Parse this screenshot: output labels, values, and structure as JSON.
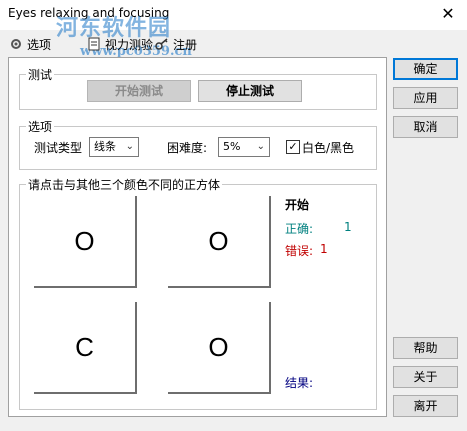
{
  "window": {
    "title": "Eyes relaxing and focusing",
    "close_glyph": "✕",
    "watermark_text": "河东软件园",
    "watermark_url": "www.pc0359.cn"
  },
  "tabs": [
    {
      "label": "选项",
      "icon": "gear-icon"
    },
    {
      "label": "视力测验",
      "icon": "document-icon"
    },
    {
      "label": "注册",
      "icon": "key-icon"
    }
  ],
  "test_group": {
    "legend": "测试",
    "start_label": "开始测试",
    "stop_label": "停止测试"
  },
  "options_group": {
    "legend": "选项",
    "test_type_label": "测试类型",
    "test_type_value": "线条",
    "difficulty_label": "困难度:",
    "difficulty_value": "5%",
    "bw_label": "白色/黑色",
    "bw_checked": true
  },
  "grid_group": {
    "legend": "请点击与其他三个颜色不同的正方体",
    "cells": [
      "O",
      "O",
      "C",
      "O"
    ]
  },
  "status": {
    "heading": "开始",
    "correct_label": "正确:",
    "correct_value": "1",
    "wrong_label": "错误:",
    "wrong_value": "1",
    "result_label": "结果:",
    "colors": {
      "correct": "#00807f",
      "wrong": "#c00000",
      "result": "#000080"
    }
  },
  "side_buttons": {
    "ok": "确定",
    "apply": "应用",
    "cancel": "取消",
    "help": "帮助",
    "about": "关于",
    "exit": "离开"
  }
}
